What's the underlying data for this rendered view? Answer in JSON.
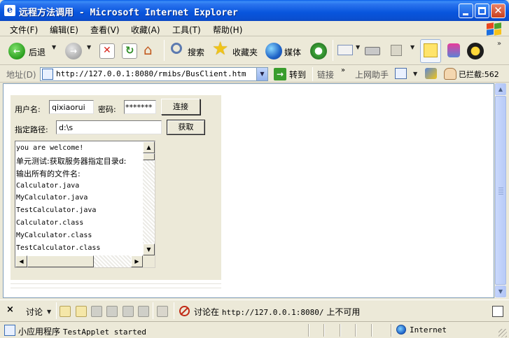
{
  "window": {
    "title": "远程方法调用 - Microsoft Internet Explorer"
  },
  "menu": [
    "文件(F)",
    "编辑(E)",
    "查看(V)",
    "收藏(A)",
    "工具(T)",
    "帮助(H)"
  ],
  "toolbar": {
    "back": "后退",
    "search": "搜索",
    "favorites": "收藏夹",
    "media": "媒体"
  },
  "address": {
    "label": "地址(D)",
    "url": "http://127.0.0.1:8080/rmibs/BusClient.htm",
    "go": "转到",
    "links": "链接",
    "helper": "上网助手",
    "blocked": "已拦截:562"
  },
  "applet": {
    "username_label": "用户名:",
    "username_value": "qixiaorui",
    "password_label": "密码:",
    "password_value": "*******",
    "connect_button": "连接",
    "path_label": "指定路径:",
    "path_value": "d:\\s",
    "fetch_button": "获取",
    "output_lines": [
      "you are welcome!",
      "单元测试:获取服务器指定目录d:",
      "输出所有的文件名:",
      "Calculator.java",
      "MyCalculator.java",
      "TestCalculator.java",
      "Calculator.class",
      "MyCalculator.class",
      "TestCalculator.class"
    ]
  },
  "discuss": {
    "close": "×",
    "label": "讨论",
    "status_prefix": "讨论在",
    "status_url": "http://127.0.0.1:8080/",
    "status_suffix": "上不可用"
  },
  "status": {
    "prefix": "小应用程序",
    "message": "TestApplet started",
    "zone": "Internet"
  }
}
